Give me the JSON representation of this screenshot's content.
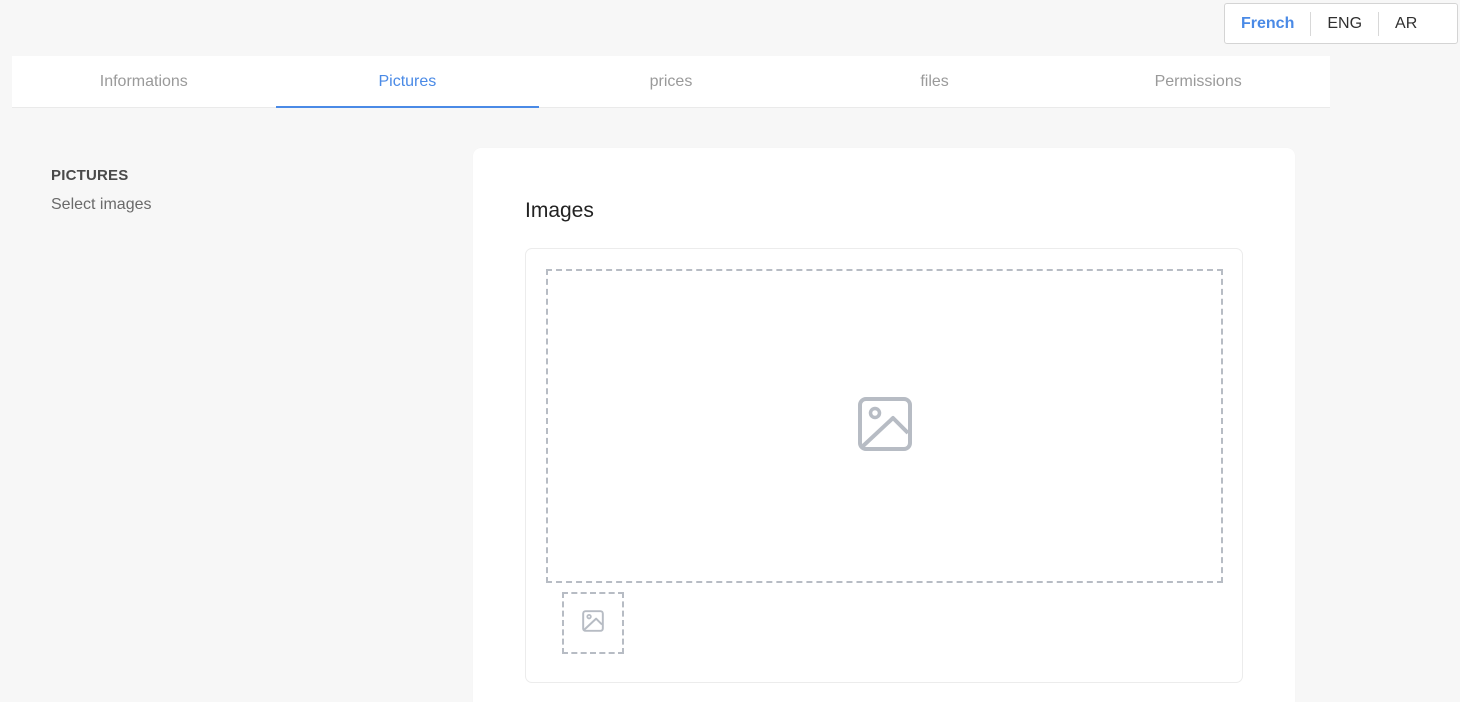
{
  "language_switcher": {
    "options": [
      {
        "label": "French",
        "active": true
      },
      {
        "label": "ENG",
        "active": false
      },
      {
        "label": "AR",
        "active": false
      }
    ]
  },
  "tabs": [
    {
      "label": "Informations",
      "active": false
    },
    {
      "label": "Pictures",
      "active": true
    },
    {
      "label": "prices",
      "active": false
    },
    {
      "label": "files",
      "active": false
    },
    {
      "label": "Permissions",
      "active": false
    }
  ],
  "section": {
    "title": "PICTURES",
    "subtitle": "Select images"
  },
  "card": {
    "title": "Images",
    "dropzone_icon": "image-placeholder-icon",
    "thumbnail_icon": "image-placeholder-icon"
  },
  "colors": {
    "accent": "#4a8ae6",
    "placeholder_icon": "#b7bcc4",
    "background": "#f7f7f7"
  }
}
